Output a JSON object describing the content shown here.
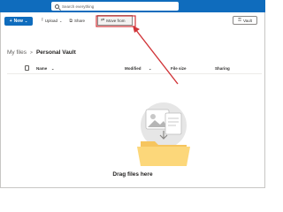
{
  "header": {
    "search_placeholder": "Search everything"
  },
  "toolbar": {
    "new_label": "New",
    "upload_label": "Upload",
    "share_label": "Share",
    "move_from_label": "Move from",
    "vault_label": "Vault"
  },
  "breadcrumb": {
    "root": "My files",
    "separator": ">",
    "current": "Personal Vault"
  },
  "table": {
    "columns": [
      "Name",
      "Modified",
      "File size",
      "Sharing"
    ]
  },
  "empty_state": {
    "message": "Drag files here"
  },
  "colors": {
    "brand": "#0f6cbd",
    "annotation": "#d13438"
  },
  "icons": [
    "search-icon",
    "plus-icon",
    "upload-icon",
    "share-icon",
    "move-from-icon",
    "vault-icon",
    "file-icon",
    "folder-illustration"
  ]
}
